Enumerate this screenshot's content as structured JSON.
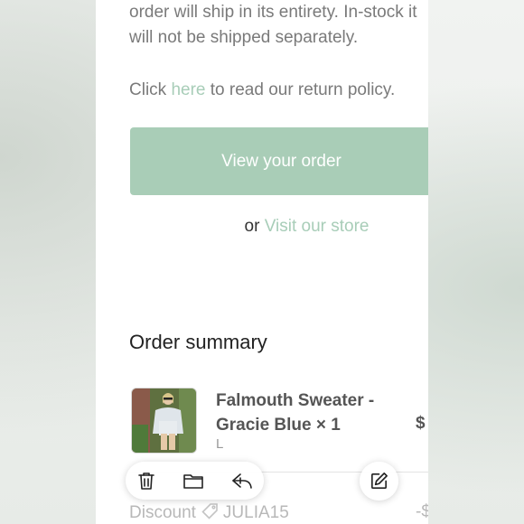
{
  "email": {
    "paragraph_line1": "order will ship in its entirety. In-stock it",
    "paragraph_line2": "will not be shipped separately.",
    "return_prefix": "Click ",
    "return_link": "here",
    "return_suffix": " to read our return policy.",
    "view_order_button": "View your order",
    "or_text": "or ",
    "visit_store_link": "Visit our store",
    "order_summary_title": "Order summary",
    "item": {
      "name": "Falmouth Sweater - Gracie Blue × 1",
      "variant": "L",
      "price": "$"
    },
    "discount": {
      "label": "Discount",
      "code": "JULIA15",
      "amount": "-$"
    }
  },
  "toolbar": {
    "icons": [
      "trash-icon",
      "folder-icon",
      "reply-icon"
    ],
    "compose_icon": "compose-icon"
  },
  "colors": {
    "accent_green": "#a9cdb7",
    "link_green": "#a8cdb8"
  }
}
